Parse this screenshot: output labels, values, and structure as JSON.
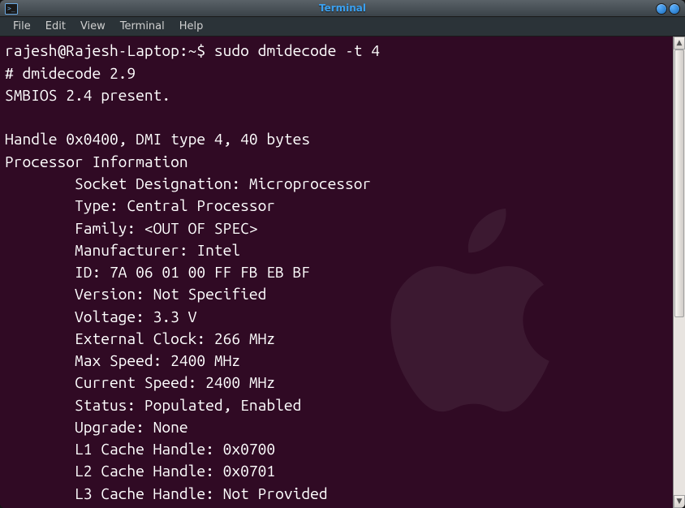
{
  "titlebar": {
    "title": "Terminal"
  },
  "menubar": {
    "items": [
      "File",
      "Edit",
      "View",
      "Terminal",
      "Help"
    ]
  },
  "terminal": {
    "prompt": "rajesh@Rajesh-Laptop:~$ ",
    "command": "sudo dmidecode -t 4",
    "lines": [
      "# dmidecode 2.9",
      "SMBIOS 2.4 present.",
      "",
      "Handle 0x0400, DMI type 4, 40 bytes",
      "Processor Information",
      "        Socket Designation: Microprocessor",
      "        Type: Central Processor",
      "        Family: <OUT OF SPEC>",
      "        Manufacturer: Intel",
      "        ID: 7A 06 01 00 FF FB EB BF",
      "        Version: Not Specified",
      "        Voltage: 3.3 V",
      "        External Clock: 266 MHz",
      "        Max Speed: 2400 MHz",
      "        Current Speed: 2400 MHz",
      "        Status: Populated, Enabled",
      "        Upgrade: None",
      "        L1 Cache Handle: 0x0700",
      "        L2 Cache Handle: 0x0701",
      "        L3 Cache Handle: Not Provided"
    ]
  }
}
